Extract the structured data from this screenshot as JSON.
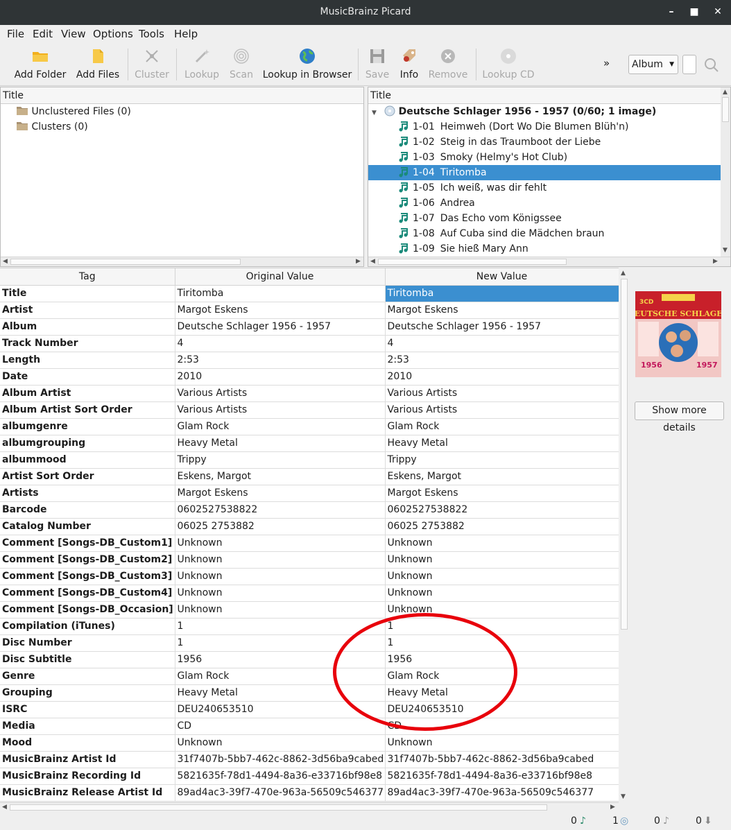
{
  "window": {
    "title": "MusicBrainz Picard"
  },
  "menu": [
    "File",
    "Edit",
    "View",
    "Options",
    "Tools",
    "Help"
  ],
  "toolbar": {
    "add_folder": "Add Folder",
    "add_files": "Add Files",
    "cluster": "Cluster",
    "lookup": "Lookup",
    "scan": "Scan",
    "lookup_browser": "Lookup in Browser",
    "save": "Save",
    "info": "Info",
    "remove": "Remove",
    "lookup_cd": "Lookup CD",
    "overflow": "»",
    "mode_select": "Album"
  },
  "left_pane": {
    "header": "Title",
    "items": [
      "Unclustered Files (0)",
      "Clusters (0)"
    ]
  },
  "right_pane": {
    "header": "Title",
    "album": "Deutsche Schlager 1956 - 1957 (0/60; 1 image)",
    "tracks": [
      {
        "num": "1-01",
        "title": "Heimweh (Dort Wo Die Blumen Blüh'n)"
      },
      {
        "num": "1-02",
        "title": "Steig in das Traumboot der Liebe"
      },
      {
        "num": "1-03",
        "title": "Smoky (Helmy's Hot Club)"
      },
      {
        "num": "1-04",
        "title": "Tiritomba"
      },
      {
        "num": "1-05",
        "title": "Ich weiß, was dir fehlt"
      },
      {
        "num": "1-06",
        "title": "Andrea"
      },
      {
        "num": "1-07",
        "title": "Das Echo vom Königssee"
      },
      {
        "num": "1-08",
        "title": "Auf Cuba sind die Mädchen braun"
      },
      {
        "num": "1-09",
        "title": "Sie hieß Mary Ann"
      }
    ],
    "selected_track_index": 3
  },
  "metadata": {
    "columns": [
      "Tag",
      "Original Value",
      "New Value"
    ],
    "rows": [
      [
        "Title",
        "Tiritomba",
        "Tiritomba"
      ],
      [
        "Artist",
        "Margot Eskens",
        "Margot Eskens"
      ],
      [
        "Album",
        "Deutsche Schlager 1956 - 1957",
        "Deutsche Schlager 1956 - 1957"
      ],
      [
        "Track Number",
        "4",
        "4"
      ],
      [
        "Length",
        "2:53",
        "2:53"
      ],
      [
        "Date",
        "2010",
        "2010"
      ],
      [
        "Album Artist",
        "Various Artists",
        "Various Artists"
      ],
      [
        "Album Artist Sort Order",
        "Various Artists",
        "Various Artists"
      ],
      [
        "albumgenre",
        "Glam Rock",
        "Glam Rock"
      ],
      [
        "albumgrouping",
        "Heavy Metal",
        "Heavy Metal"
      ],
      [
        "albummood",
        "Trippy",
        "Trippy"
      ],
      [
        "Artist Sort Order",
        "Eskens, Margot",
        "Eskens, Margot"
      ],
      [
        "Artists",
        "Margot Eskens",
        "Margot Eskens"
      ],
      [
        "Barcode",
        "0602527538822",
        "0602527538822"
      ],
      [
        "Catalog Number",
        "06025 2753882",
        "06025 2753882"
      ],
      [
        "Comment [Songs-DB_Custom1]",
        "Unknown",
        "Unknown"
      ],
      [
        "Comment [Songs-DB_Custom2]",
        "Unknown",
        "Unknown"
      ],
      [
        "Comment [Songs-DB_Custom3]",
        "Unknown",
        "Unknown"
      ],
      [
        "Comment [Songs-DB_Custom4]",
        "Unknown",
        "Unknown"
      ],
      [
        "Comment [Songs-DB_Occasion]",
        "Unknown",
        "Unknown"
      ],
      [
        "Compilation (iTunes)",
        "1",
        "1"
      ],
      [
        "Disc Number",
        "1",
        "1"
      ],
      [
        "Disc Subtitle",
        "1956",
        "1956"
      ],
      [
        "Genre",
        "Glam Rock",
        "Glam Rock"
      ],
      [
        "Grouping",
        "Heavy Metal",
        "Heavy Metal"
      ],
      [
        "ISRC",
        "DEU240653510",
        "DEU240653510"
      ],
      [
        "Media",
        "CD",
        "CD"
      ],
      [
        "Mood",
        "Unknown",
        "Unknown"
      ],
      [
        "MusicBrainz Artist Id",
        "31f7407b-5bb7-462c-8862-3d56ba9cabed",
        "31f7407b-5bb7-462c-8862-3d56ba9cabed"
      ],
      [
        "MusicBrainz Recording Id",
        "5821635f-78d1-4494-8a36-e33716bf98e8",
        "5821635f-78d1-4494-8a36-e33716bf98e8"
      ],
      [
        "MusicBrainz Release Artist Id",
        "89ad4ac3-39f7-470e-963a-56509c546377",
        "89ad4ac3-39f7-470e-963a-56509c546377"
      ]
    ]
  },
  "cover_art": {
    "top_text": "3CD",
    "title": "DEUTSCHE SCHLAGER",
    "year_left": "1956",
    "year_right": "1957"
  },
  "show_more_button": "Show more details",
  "status": {
    "files": "0",
    "albums": "1",
    "pending_files": "0",
    "pending_requests": "0"
  },
  "colors": {
    "selection": "#3b8fd0",
    "annotation_ring": "#e8000b",
    "music_note": "#1a8a7a",
    "titlebar": "#2f3436"
  }
}
